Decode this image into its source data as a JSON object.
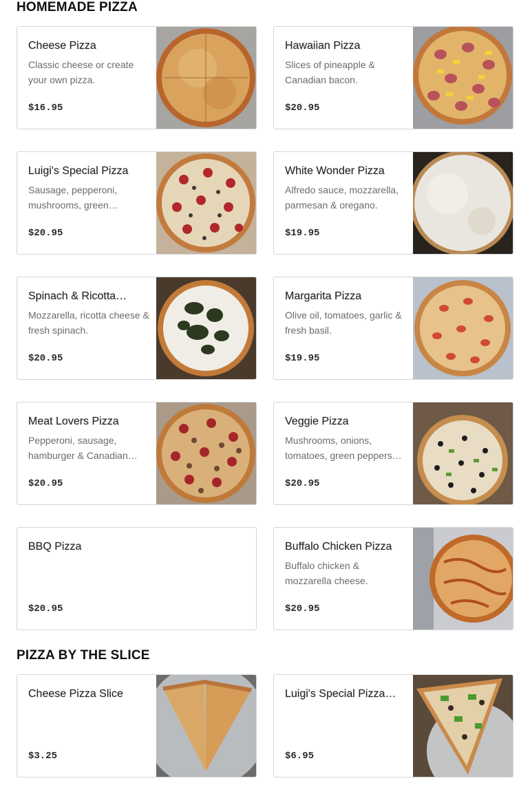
{
  "sections": [
    {
      "title": "HOMEMADE PIZZA",
      "items": [
        {
          "name": "Cheese Pizza",
          "desc": "Classic cheese or create your own pizza.",
          "price": "$16.95",
          "photo": "cheese-pizza-photo"
        },
        {
          "name": "Hawaiian Pizza",
          "desc": "Slices of pineapple & Canadian bacon.",
          "price": "$20.95",
          "photo": "hawaiian-pizza-photo"
        },
        {
          "name": "Luigi's Special Pizza",
          "desc": "Sausage, pepperoni, mushrooms, green…",
          "price": "$20.95",
          "photo": "luigis-special-photo"
        },
        {
          "name": "White Wonder Pizza",
          "desc": "Alfredo sauce, mozzarella, parmesan & oregano.",
          "price": "$19.95",
          "photo": "white-wonder-photo"
        },
        {
          "name": "Spinach & Ricotta…",
          "desc": "Mozzarella, ricotta cheese & fresh spinach.",
          "price": "$20.95",
          "photo": "spinach-ricotta-photo"
        },
        {
          "name": "Margarita Pizza",
          "desc": "Olive oil, tomatoes, garlic & fresh basil.",
          "price": "$19.95",
          "photo": "margarita-photo"
        },
        {
          "name": "Meat Lovers Pizza",
          "desc": "Pepperoni, sausage, hamburger & Canadian…",
          "price": "$20.95",
          "photo": "meat-lovers-photo"
        },
        {
          "name": "Veggie Pizza",
          "desc": "Mushrooms, onions, tomatoes, green peppers…",
          "price": "$20.95",
          "photo": "veggie-photo"
        },
        {
          "name": "BBQ Pizza",
          "desc": "",
          "price": "$20.95",
          "photo": ""
        },
        {
          "name": "Buffalo Chicken Pizza",
          "desc": "Buffalo chicken & mozzarella cheese.",
          "price": "$20.95",
          "photo": "buffalo-chicken-photo"
        }
      ]
    },
    {
      "title": "PIZZA BY THE SLICE",
      "items": [
        {
          "name": "Cheese Pizza Slice",
          "desc": "",
          "price": "$3.25",
          "photo": "cheese-slice-photo"
        },
        {
          "name": "Luigi's Special Pizza…",
          "desc": "",
          "price": "$6.95",
          "photo": "luigis-slice-photo"
        }
      ]
    }
  ]
}
